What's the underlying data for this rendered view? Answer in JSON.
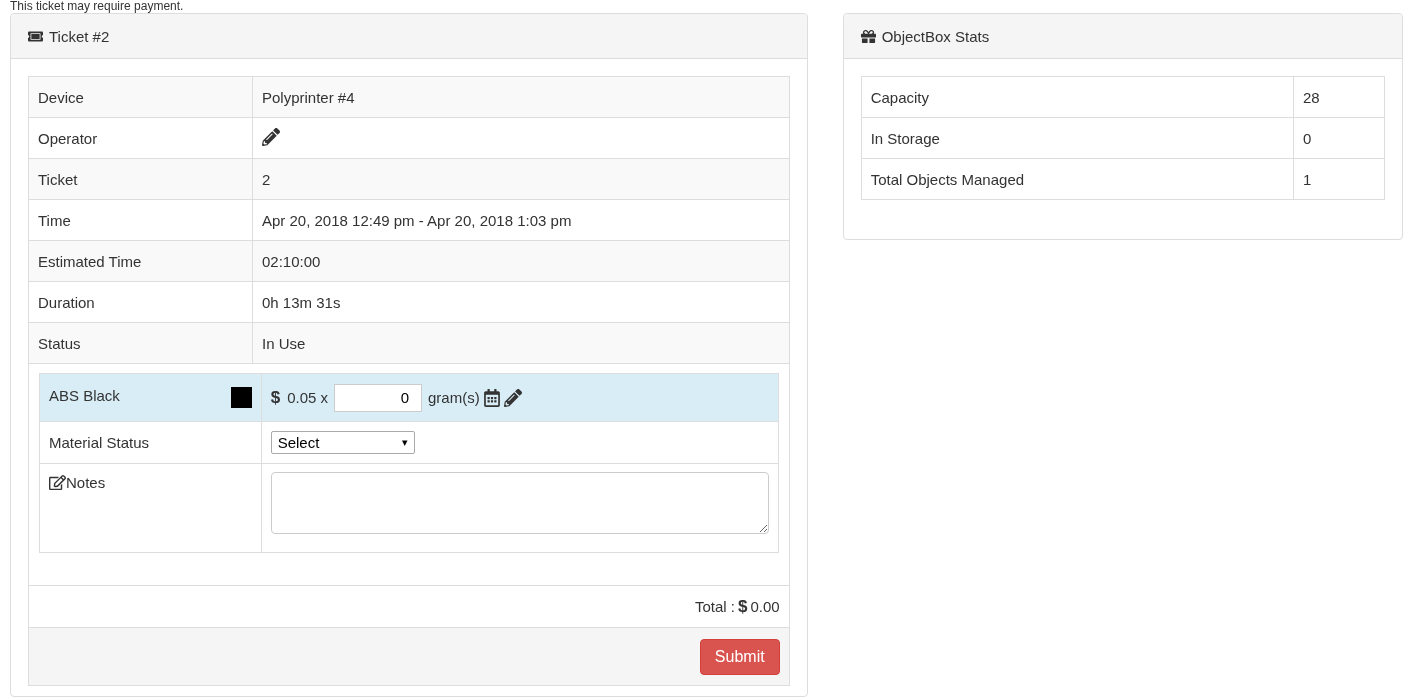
{
  "notice": "This ticket may require payment.",
  "ticket_panel": {
    "title": "Ticket #2",
    "rows": [
      {
        "label": "Device",
        "value": "Polyprinter #4",
        "kind": "text"
      },
      {
        "label": "Operator",
        "kind": "edit"
      },
      {
        "label": "Ticket",
        "value": "2",
        "kind": "text"
      },
      {
        "label": "Time",
        "value": "Apr 20, 2018 12:49 pm - Apr 20, 2018 1:03 pm",
        "kind": "text"
      },
      {
        "label": "Estimated Time",
        "value": "02:10:00",
        "kind": "text"
      },
      {
        "label": "Duration",
        "value": "0h 13m 31s",
        "kind": "text"
      },
      {
        "label": "Status",
        "value": "In Use",
        "kind": "text"
      }
    ],
    "material": {
      "name": "ABS Black",
      "color": "#000000",
      "currency": "$",
      "rate": "0.05 x",
      "quantity": "0",
      "unit": "gram(s)"
    },
    "material_status": {
      "label": "Material Status",
      "value": "Select",
      "arrow": "▾"
    },
    "notes": {
      "label": "Notes"
    },
    "total": {
      "label": "Total :",
      "currency": "$",
      "amount": "0.00"
    },
    "submit": "Submit"
  },
  "stats_panel": {
    "title": "ObjectBox Stats",
    "rows": [
      {
        "label": "Capacity",
        "value": "28"
      },
      {
        "label": "In Storage",
        "value": "0"
      },
      {
        "label": "Total Objects Managed",
        "value": "1"
      }
    ]
  }
}
